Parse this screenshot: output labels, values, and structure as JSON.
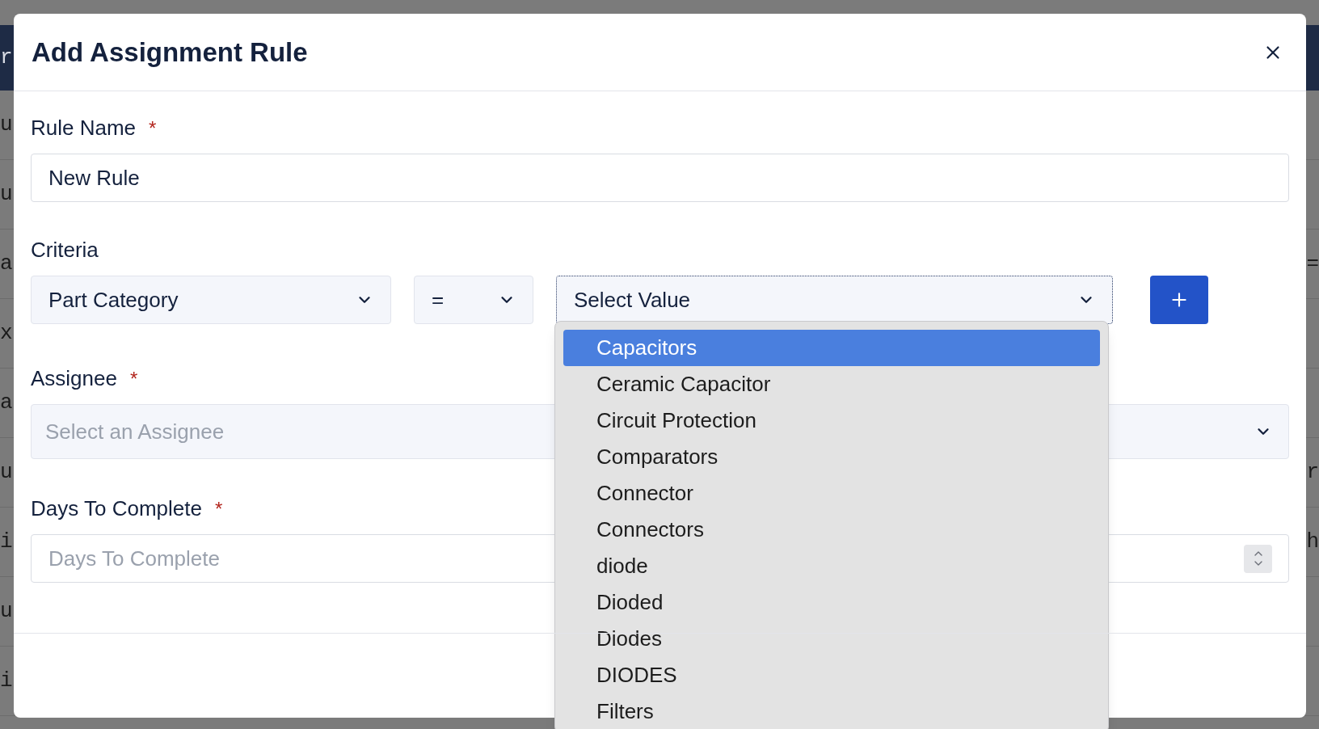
{
  "background": {
    "header_fragment": "r",
    "rows": [
      {
        "left": "u"
      },
      {
        "left": "u"
      },
      {
        "left": "a",
        "right": "="
      },
      {
        "left": "x"
      },
      {
        "left": "a"
      },
      {
        "left": "u",
        "right": "r"
      },
      {
        "left": "i",
        "right": "h"
      },
      {
        "left": "u"
      },
      {
        "left": "i"
      }
    ]
  },
  "dialog": {
    "title": "Add Assignment Rule",
    "rule_name": {
      "label": "Rule Name",
      "required_mark": "*",
      "value": "New Rule"
    },
    "criteria": {
      "label": "Criteria",
      "field": {
        "value": "Part Category"
      },
      "operator": {
        "value": "="
      },
      "value_select": {
        "value": "Select Value",
        "expanded": true
      },
      "options": [
        {
          "label": "Capacitors",
          "selected": true
        },
        {
          "label": "Ceramic Capacitor",
          "selected": false
        },
        {
          "label": "Circuit Protection",
          "selected": false
        },
        {
          "label": "Comparators",
          "selected": false
        },
        {
          "label": "Connector",
          "selected": false
        },
        {
          "label": "Connectors",
          "selected": false
        },
        {
          "label": "diode",
          "selected": false
        },
        {
          "label": "Dioded",
          "selected": false
        },
        {
          "label": "Diodes",
          "selected": false
        },
        {
          "label": "DIODES",
          "selected": false
        },
        {
          "label": "Filters",
          "selected": false
        }
      ]
    },
    "assignee": {
      "label": "Assignee",
      "required_mark": "*",
      "placeholder": "Select an Assignee"
    },
    "days": {
      "label": "Days To Complete",
      "required_mark": "*",
      "placeholder": "Days To Complete"
    }
  }
}
